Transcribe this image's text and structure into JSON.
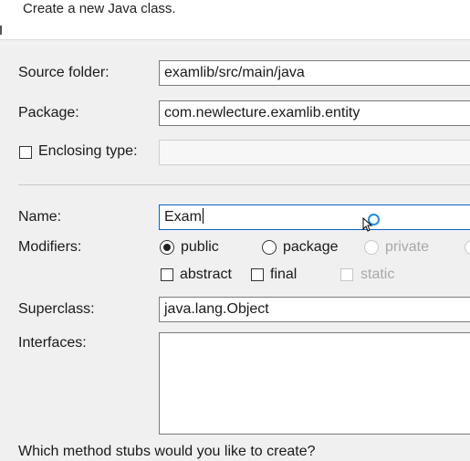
{
  "header": {
    "description": "Create a new Java class."
  },
  "source_folder": {
    "label": "Source folder:",
    "value": "examlib/src/main/java"
  },
  "package": {
    "label": "Package:",
    "value": "com.newlecture.examlib.entity"
  },
  "enclosing_type": {
    "label": "Enclosing type:",
    "value": "",
    "checked": false
  },
  "name": {
    "label": "Name:",
    "value": "Exam"
  },
  "modifiers": {
    "label": "Modifiers:",
    "access": [
      {
        "label": "public",
        "selected": true,
        "enabled": true
      },
      {
        "label": "package",
        "selected": false,
        "enabled": true
      },
      {
        "label": "private",
        "selected": false,
        "enabled": false
      }
    ],
    "flags": [
      {
        "label": "abstract",
        "checked": false,
        "enabled": true
      },
      {
        "label": "final",
        "checked": false,
        "enabled": true
      },
      {
        "label": "static",
        "checked": false,
        "enabled": false
      }
    ]
  },
  "superclass": {
    "label": "Superclass:",
    "value": "java.lang.Object"
  },
  "interfaces": {
    "label": "Interfaces:"
  },
  "method_stubs": {
    "question": "Which method stubs would you like to create?"
  },
  "colors": {
    "focus_border": "#0a64c8",
    "busy_indicator": "#1e8fe0"
  },
  "icons": {
    "cursor": "arrow-busy-cursor-icon"
  }
}
